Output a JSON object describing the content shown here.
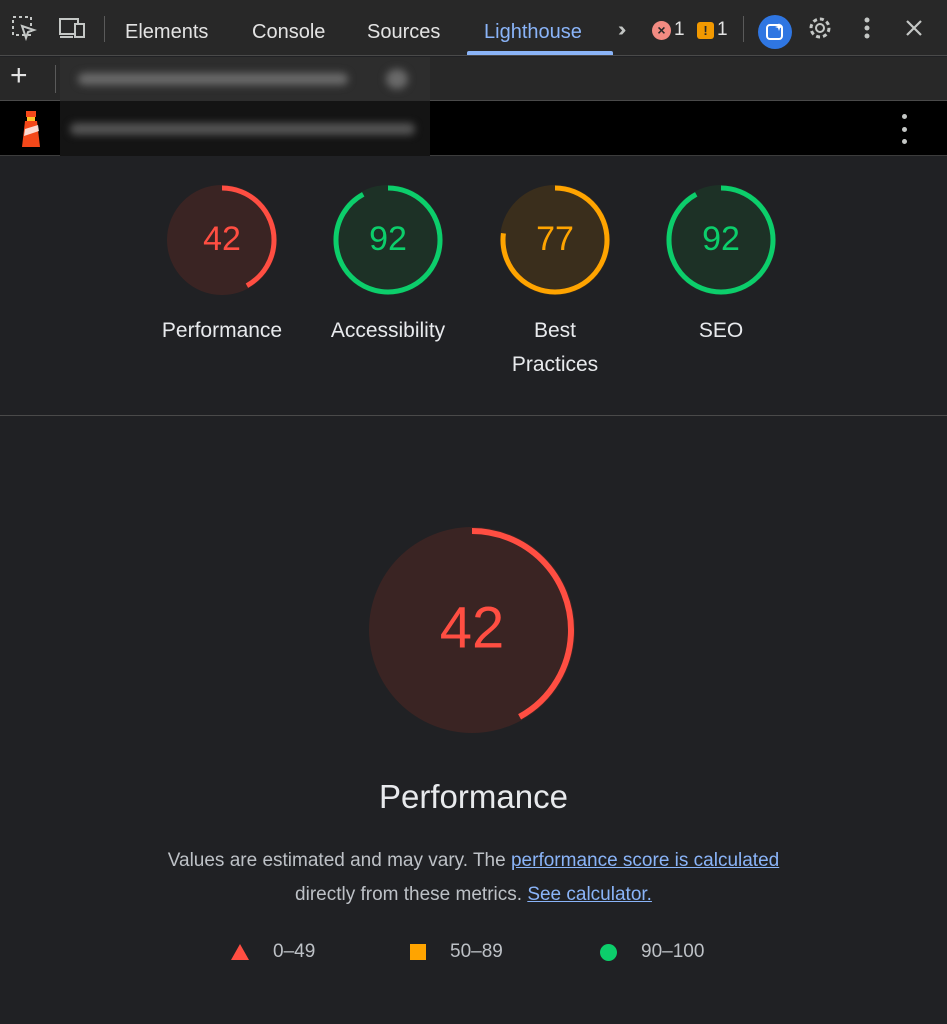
{
  "toolbar": {
    "tabs": [
      "Elements",
      "Console",
      "Sources",
      "Lighthouse"
    ],
    "active_tab": "Lighthouse",
    "error_count": "1",
    "warning_count": "1",
    "icons": [
      "inspect-element-icon",
      "device-toolbar-icon",
      "more-tabs-icon",
      "error-icon",
      "warning-icon",
      "ai-assistant-icon",
      "gear-icon",
      "more-options-icon",
      "close-icon"
    ]
  },
  "report_bar": {
    "add_label": "+"
  },
  "scores": [
    {
      "label": "Performance",
      "score": 42,
      "color": "#ff4e42",
      "fill": "#3a2423"
    },
    {
      "label": "Accessibility",
      "score": 92,
      "color": "#0cce6b",
      "fill": "#1d3126"
    },
    {
      "label": "Best Practices",
      "score": 77,
      "color": "#ffa400",
      "fill": "#3a2e1c"
    },
    {
      "label": "SEO",
      "score": 92,
      "color": "#0cce6b",
      "fill": "#1d3126"
    }
  ],
  "main": {
    "score": 42,
    "title": "Performance",
    "desc_prefix": "Values are estimated and may vary. The ",
    "desc_link": "performance score is calculated",
    "desc_middle": " directly from these metrics. ",
    "desc_link2": "See calculator."
  },
  "legend": {
    "fail": "0–49",
    "average": "50–89",
    "pass": "90–100"
  },
  "colors": {
    "fail": "#ff4e42",
    "average": "#ffa400",
    "pass": "#0cce6b",
    "accent": "#8ab4f8"
  }
}
